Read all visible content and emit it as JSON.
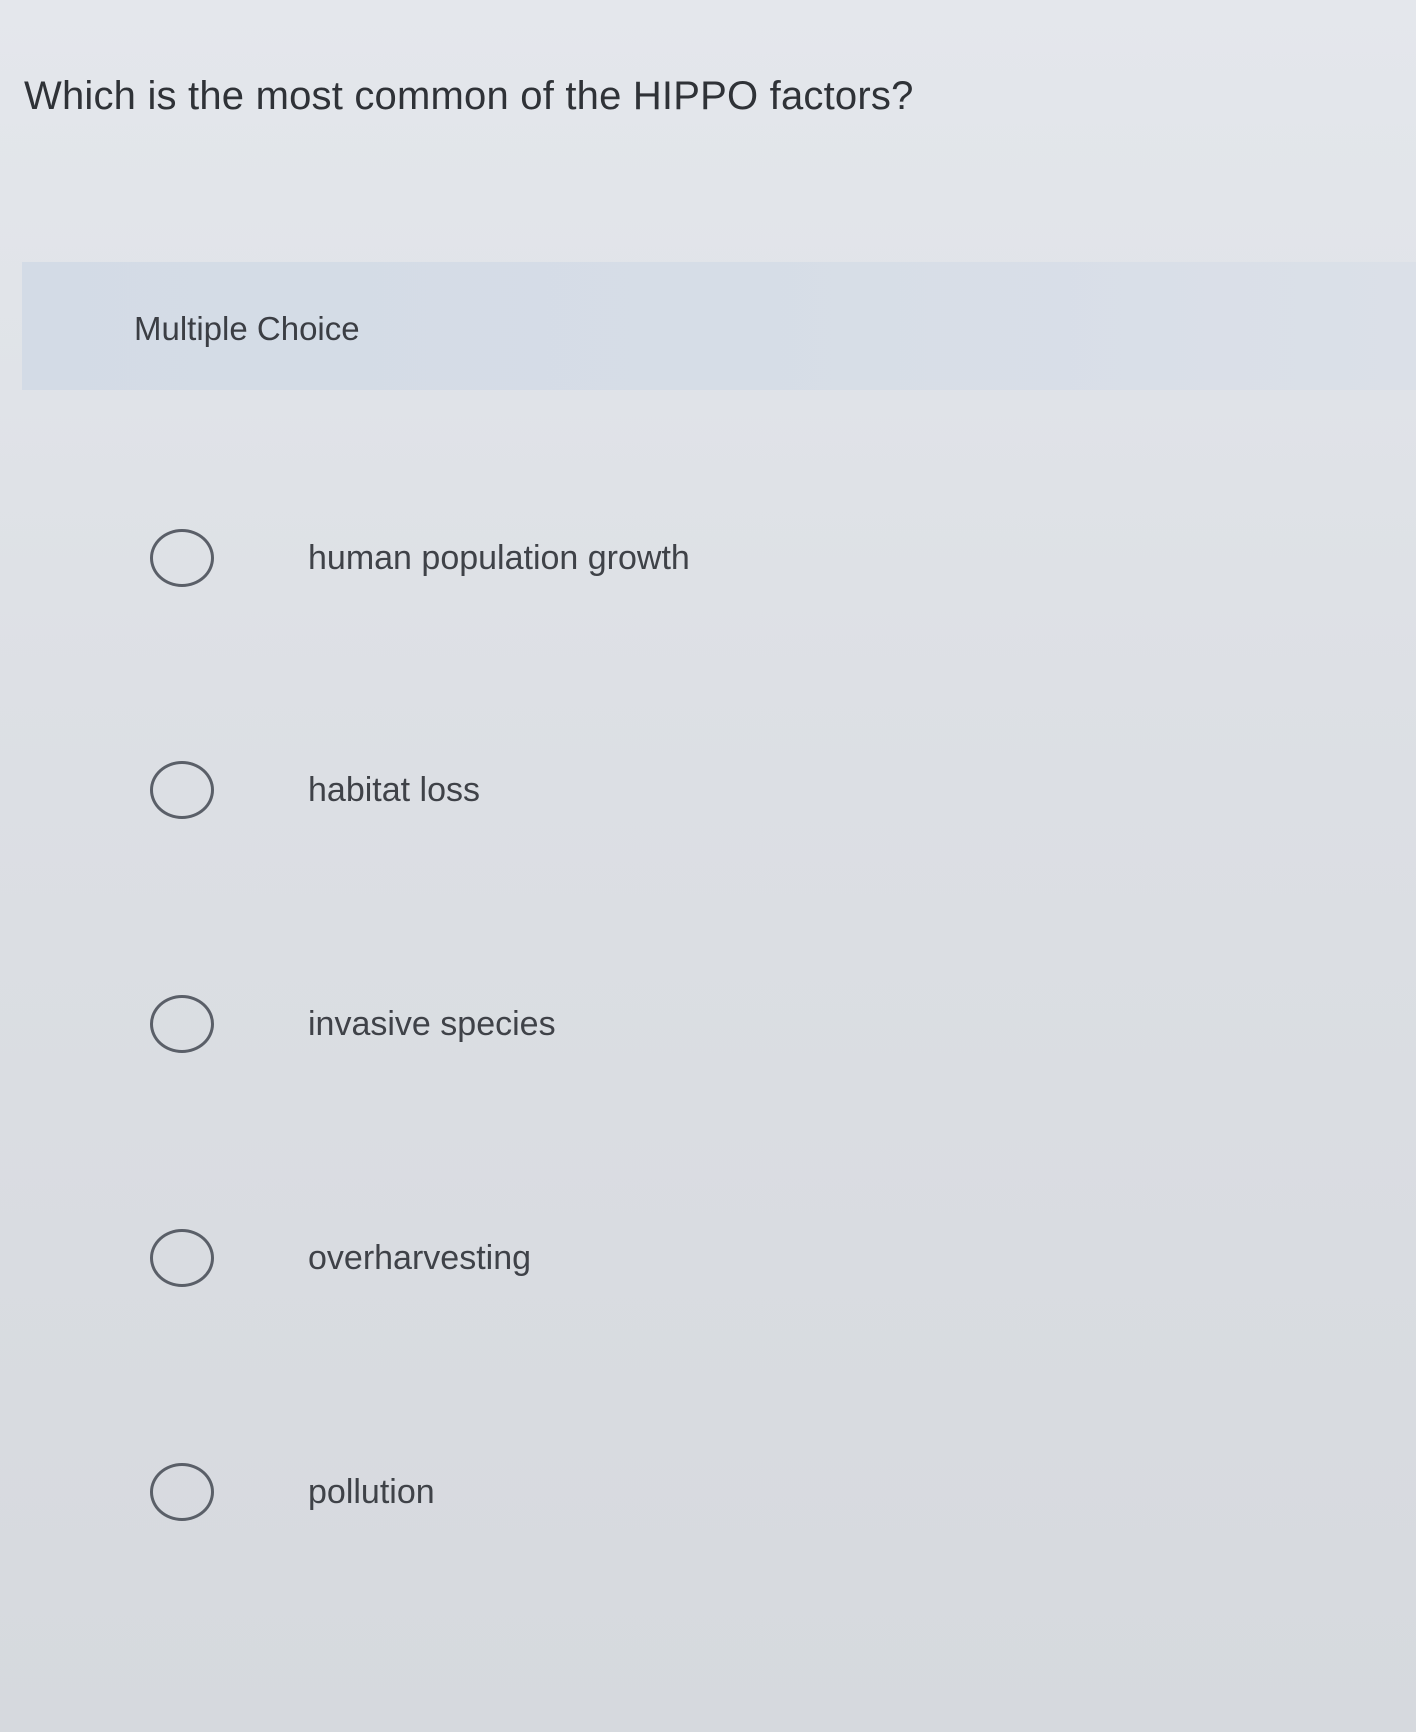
{
  "question": "Which is the most common of the HIPPO factors?",
  "question_type": "Multiple Choice",
  "options": [
    "human population growth",
    "habitat loss",
    "invasive species",
    "overharvesting",
    "pollution"
  ],
  "icons": {
    "radio": "radio-circle-icon"
  }
}
